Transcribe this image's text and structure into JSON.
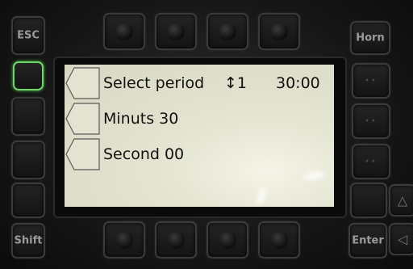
{
  "keys": {
    "esc": "ESC",
    "horn": "Horn",
    "shift": "Shift",
    "enter": "Enter"
  },
  "screen": {
    "rows": [
      {
        "label": "Select period",
        "indicator": "↕1",
        "value": "30:00"
      },
      {
        "label": "Minuts 30"
      },
      {
        "label": "Second 00"
      }
    ]
  },
  "icons": {
    "up": "arrow-up-icon",
    "down": "arrow-down-icon"
  }
}
